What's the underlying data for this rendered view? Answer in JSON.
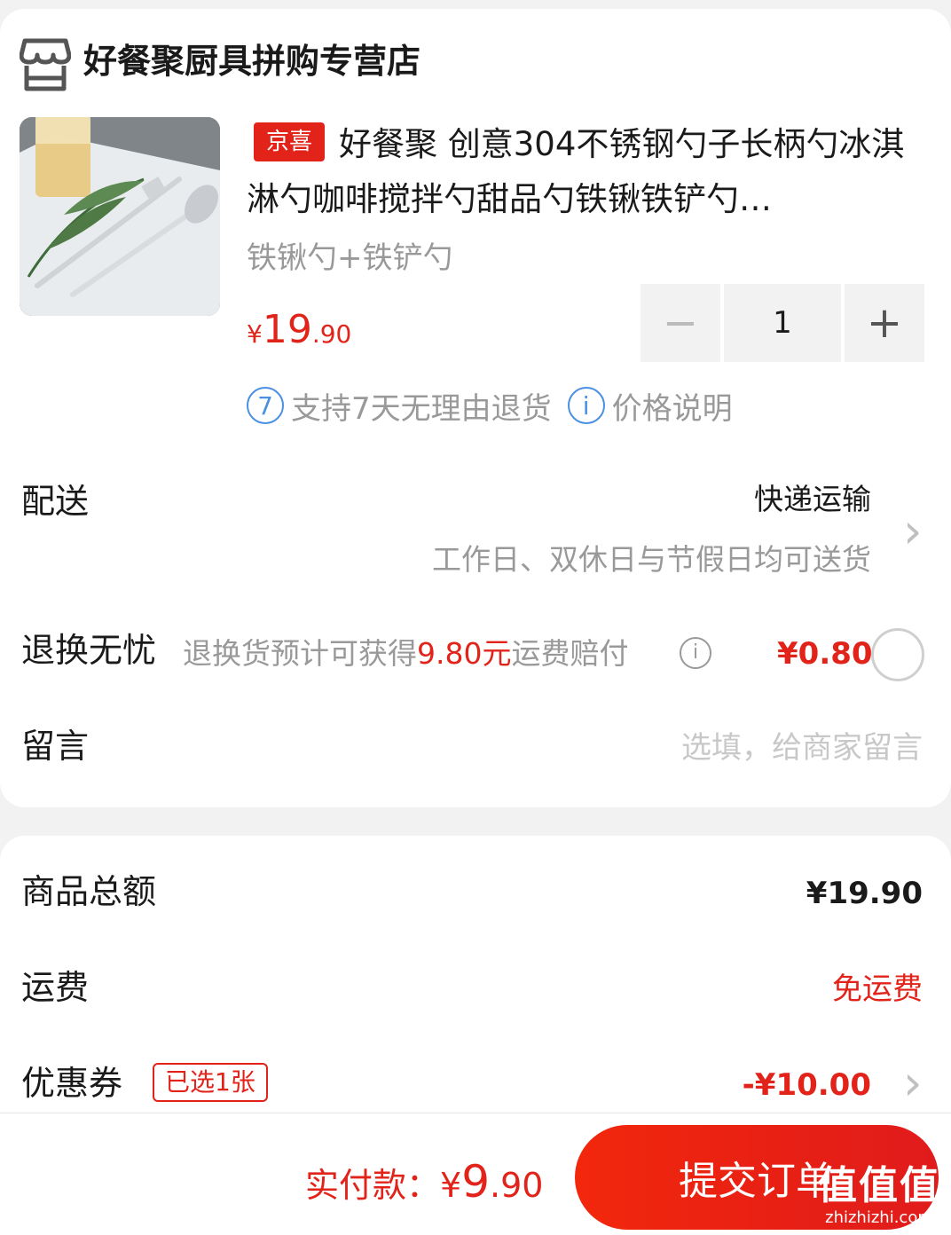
{
  "shop": {
    "name": "好餐聚厨具拼购专营店",
    "icon": "store-icon"
  },
  "product": {
    "tag": "京喜",
    "title": "好餐聚 创意304不锈钢勺子长柄勺冰淇淋勺咖啡搅拌勺甜品勺铁锹铁铲勺…",
    "variant": "铁锹勺+铁铲勺",
    "price_currency": "¥",
    "price_int": "19",
    "price_dec": ".90",
    "quantity": "1",
    "minus": "−",
    "plus": "+",
    "services": [
      {
        "icon_text": "7",
        "label": "支持7天无理由退货"
      },
      {
        "icon_text": "i",
        "label": "价格说明"
      }
    ]
  },
  "delivery": {
    "label": "配送",
    "method": "快递运输",
    "note": "工作日、双休日与节假日均可送货"
  },
  "exchange": {
    "label": "退换无忧",
    "note_pre": "退换货预计可获得",
    "note_amount": "9.80元",
    "note_post": "运费赔付",
    "info_icon": "i",
    "price": "¥0.80"
  },
  "message": {
    "label": "留言",
    "placeholder": "选填，给商家留言"
  },
  "summary": {
    "goods_total_label": "商品总额",
    "goods_total": "¥19.90",
    "shipping_label": "运费",
    "shipping": "免运费",
    "coupon_label": "优惠券",
    "coupon_badge": "已选1张",
    "coupon_value": "-¥10.00"
  },
  "footer": {
    "pay_label": "实付款：",
    "pay_currency": "¥",
    "pay_int": "9",
    "pay_dec": ".90",
    "submit": "提交订单"
  },
  "watermark": {
    "logo": "值值值",
    "url": "zhizhizhi.com"
  },
  "colors": {
    "accent": "#e2231a",
    "blue": "#4a90e2",
    "muted": "#999999"
  }
}
